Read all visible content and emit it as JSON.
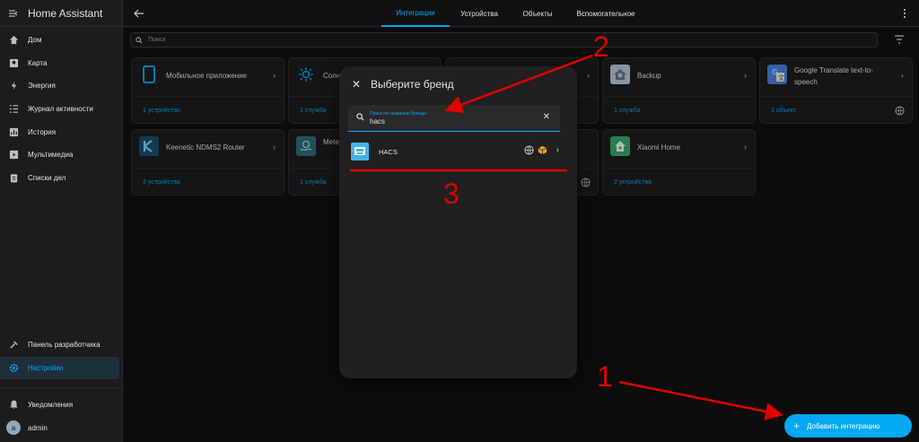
{
  "app": {
    "title": "Home Assistant"
  },
  "sidebar": {
    "items": [
      {
        "label": "Дом",
        "icon": "home-icon"
      },
      {
        "label": "Карта",
        "icon": "map-icon"
      },
      {
        "label": "Энергия",
        "icon": "lightning-icon"
      },
      {
        "label": "Журнал активности",
        "icon": "list-icon"
      },
      {
        "label": "История",
        "icon": "chart-icon"
      },
      {
        "label": "Мультимедиа",
        "icon": "play-icon"
      },
      {
        "label": "Списки дел",
        "icon": "clipboard-icon"
      }
    ],
    "bottom": [
      {
        "label": "Панель разработчика",
        "icon": "hammer-icon"
      },
      {
        "label": "Настройки",
        "icon": "gear-icon",
        "active": true
      }
    ],
    "notifications": "Уведомления",
    "user": {
      "initial": "a",
      "name": "admin"
    }
  },
  "header": {
    "tabs": [
      "Интеграции",
      "Устройства",
      "Объекты",
      "Вспомогательное"
    ],
    "active_tab": "Интеграции"
  },
  "search": {
    "placeholder": "Поиск"
  },
  "cards": [
    {
      "name": "Мобильное приложение",
      "link": "1 устройство"
    },
    {
      "name": "Солн",
      "link": "1 служба"
    },
    {
      "name": "",
      "link": ""
    },
    {
      "name": "Backup",
      "link": "1 служба"
    },
    {
      "name": "Google Translate text-to-speech",
      "link": "1 объект"
    },
    {
      "name": "Keenetic NDMS2 Router",
      "link": "2 устройства"
    },
    {
      "name": "Mete (Met.",
      "link": "1 служба"
    },
    {
      "name": "",
      "link": ""
    },
    {
      "name": "Xiaomi Home",
      "link": "2 устройства"
    }
  ],
  "dialog": {
    "title": "Выберите бренд",
    "search_label": "Поиск по названию бренда",
    "search_value": "hacs",
    "result": {
      "name": "HACS"
    }
  },
  "fab": {
    "label": "Добавить интеграцию"
  },
  "annotations": {
    "n1": "1",
    "n2": "2",
    "n3": "3"
  },
  "colors": {
    "accent": "#03a9f4",
    "annotation": "#e00000",
    "background": "#111111",
    "card": "#1c1c1c"
  }
}
